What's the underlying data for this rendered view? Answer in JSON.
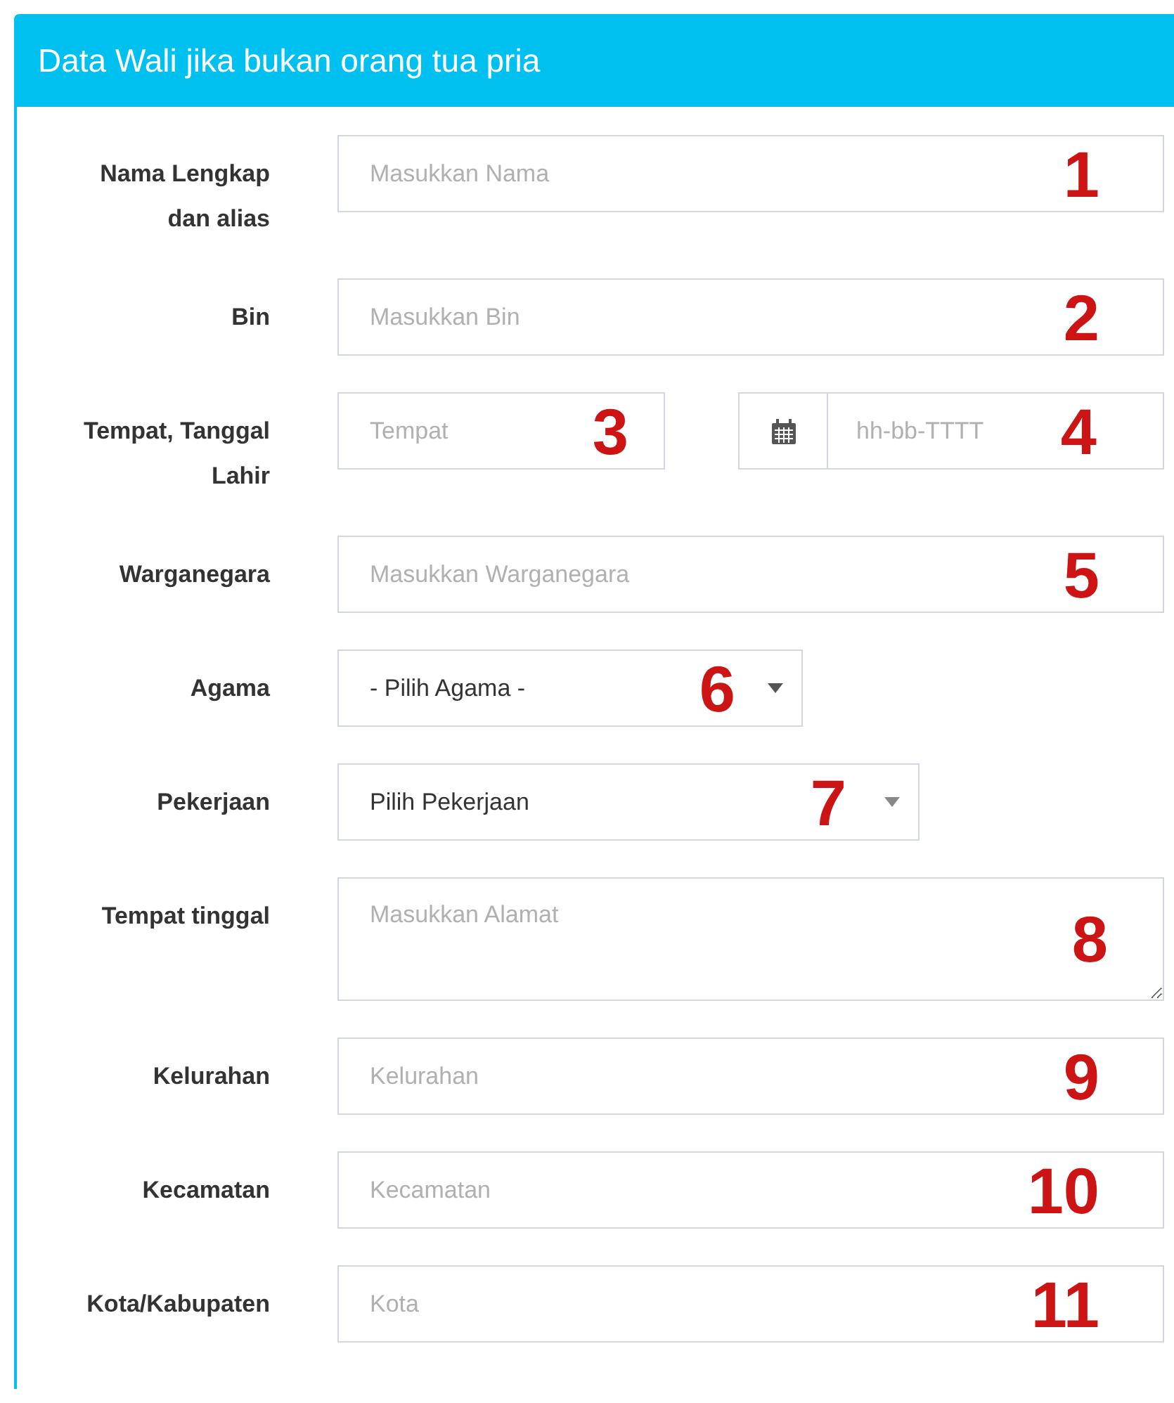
{
  "panel": {
    "title": "Data Wali jika bukan orang tua pria"
  },
  "fields": [
    {
      "kind": "text",
      "label": "Nama Lengkap dan alias",
      "placeholder": "Masukkan Nama",
      "annotation": "1"
    },
    {
      "kind": "text",
      "label": "Bin",
      "placeholder": "Masukkan Bin",
      "annotation": "2"
    },
    {
      "kind": "place-date",
      "label": "Tempat, Tanggal Lahir",
      "place": {
        "placeholder": "Tempat",
        "annotation": "3"
      },
      "date": {
        "placeholder": "hh-bb-TTTT",
        "annotation": "4"
      }
    },
    {
      "kind": "text",
      "label": "Warganegara",
      "placeholder": "Masukkan Warganegara",
      "annotation": "5"
    },
    {
      "kind": "select",
      "label": "Agama",
      "value": "- Pilih Agama -",
      "annotation": "6"
    },
    {
      "kind": "select",
      "label": "Pekerjaan",
      "value": "Pilih Pekerjaan",
      "annotation": "7"
    },
    {
      "kind": "textarea",
      "label": "Tempat tinggal",
      "placeholder": "Masukkan Alamat",
      "annotation": "8"
    },
    {
      "kind": "text",
      "label": "Kelurahan",
      "placeholder": "Kelurahan",
      "annotation": "9"
    },
    {
      "kind": "text",
      "label": "Kecamatan",
      "placeholder": "Kecamatan",
      "annotation": "10"
    },
    {
      "kind": "text",
      "label": "Kota/Kabupaten",
      "placeholder": "Kota",
      "annotation": "11"
    }
  ]
}
